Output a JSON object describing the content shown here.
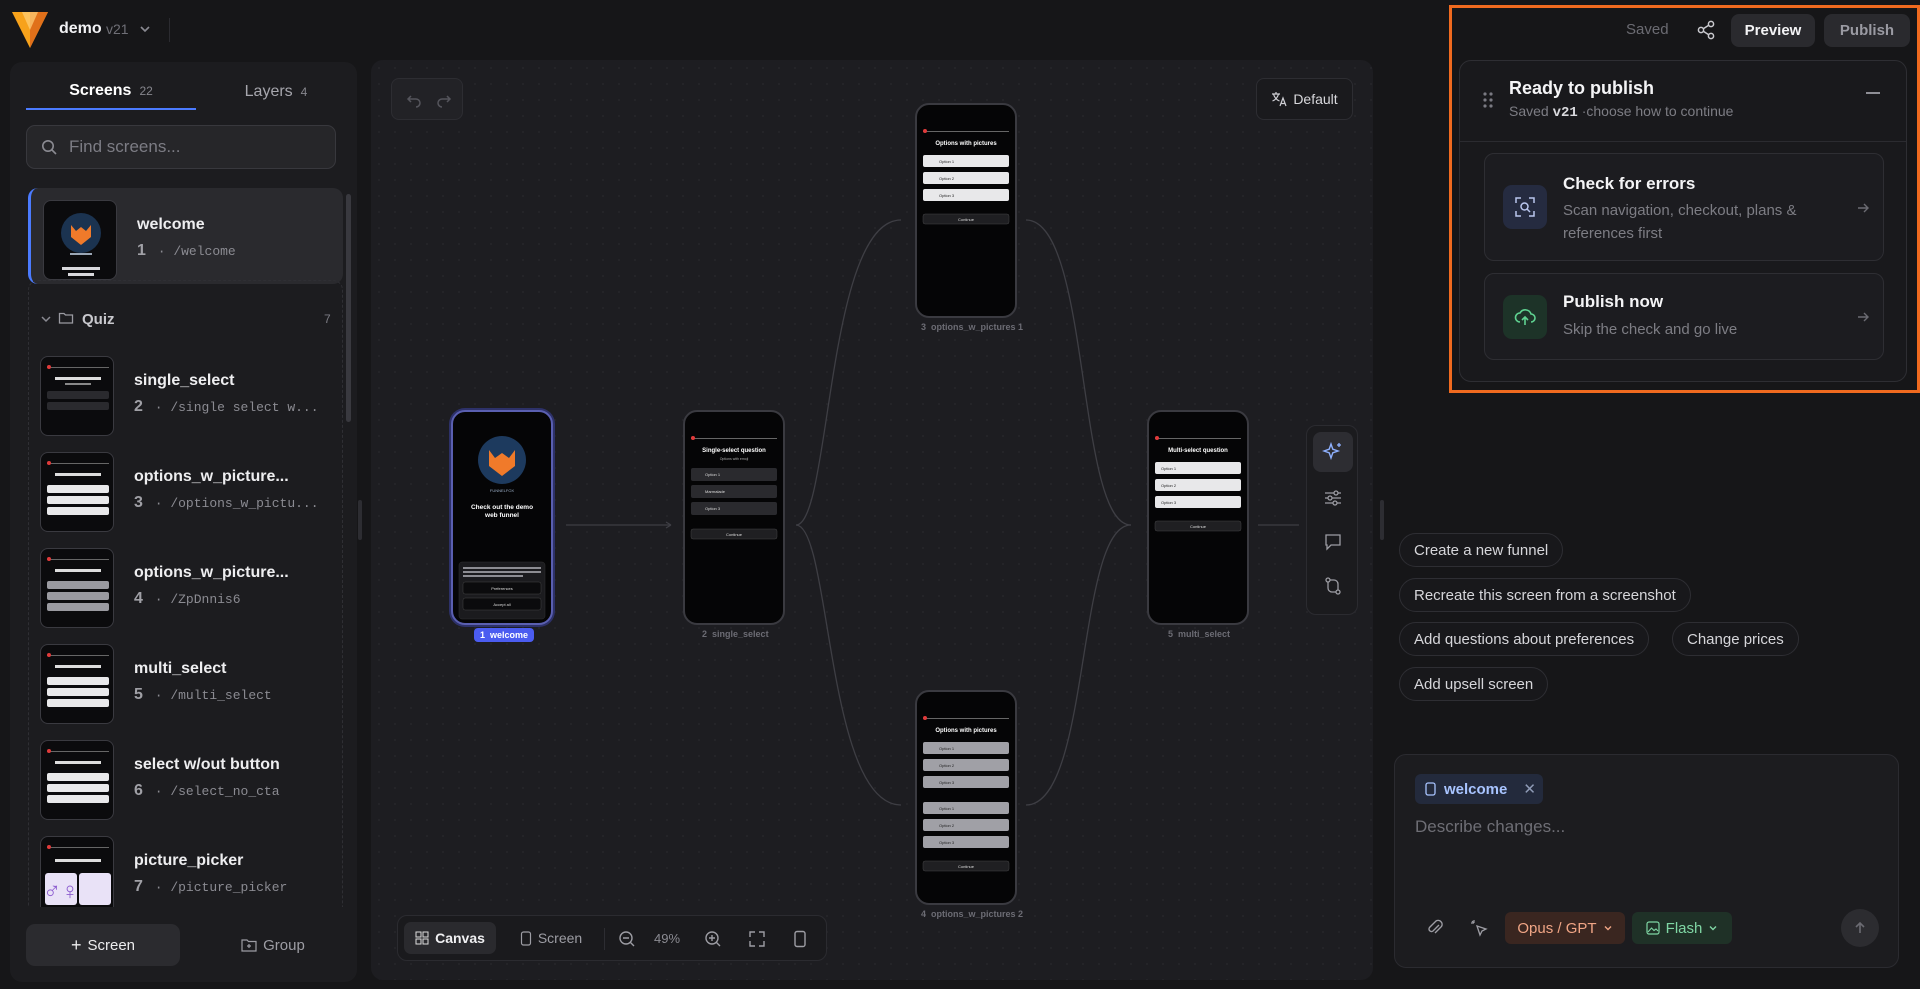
{
  "project": {
    "name": "demo",
    "version": "v21"
  },
  "header": {
    "saved_label": "Saved",
    "preview_label": "Preview",
    "publish_label": "Publish"
  },
  "sidebar": {
    "tabs": [
      {
        "label": "Screens",
        "count": "22"
      },
      {
        "label": "Layers",
        "count": "4"
      }
    ],
    "search_placeholder": "Find screens...",
    "screens": [
      {
        "name": "welcome",
        "number": "1",
        "path": "/welcome"
      },
      {
        "name": "single_select",
        "number": "2",
        "path": "/single select w..."
      },
      {
        "name": "options_w_picture...",
        "number": "3",
        "path": "/options_w_pictu..."
      },
      {
        "name": "options_w_picture...",
        "number": "4",
        "path": "/ZpDnnis6"
      },
      {
        "name": "multi_select",
        "number": "5",
        "path": "/multi_select"
      },
      {
        "name": "select w/out button",
        "number": "6",
        "path": "/select_no_cta"
      },
      {
        "name": "picture_picker",
        "number": "7",
        "path": "/picture_picker"
      }
    ],
    "group": {
      "name": "Quiz",
      "count": "7"
    },
    "add_screen_label": "Screen",
    "add_group_label": "Group"
  },
  "canvas": {
    "default_label": "Default",
    "toolbar": {
      "canvas_label": "Canvas",
      "screen_label": "Screen",
      "zoom": "49%"
    },
    "nodes": [
      {
        "number": "1",
        "label": "welcome",
        "title": "Check out the demo web funnel",
        "brand": "FUNNELFOX",
        "consent": "We use cookies to offer a better browsing experience, analyze site traffic, personalize content, and serve targeted advertisements.",
        "btn1": "Preferences",
        "btn2": "Accept all"
      },
      {
        "number": "2",
        "label": "single_select",
        "title": "Single-select question",
        "subtitle": "Options with emoji",
        "options": [
          "Option 1",
          "Marmalade",
          "Option 3"
        ],
        "cta": "Continue"
      },
      {
        "number": "3",
        "label": "options_w_pictures 1",
        "title": "Options with pictures",
        "options": [
          "Option 1",
          "Option 2",
          "Option 3"
        ],
        "cta": "Continue"
      },
      {
        "number": "4",
        "label": "options_w_pictures 2",
        "title": "Options with pictures",
        "options": [
          "Option 1",
          "Option 2",
          "Option 3",
          "Option 1",
          "Option 2",
          "Option 3"
        ],
        "cta": "Continue"
      },
      {
        "number": "5",
        "label": "multi_select",
        "title": "Multi-select question",
        "options": [
          "Option 1",
          "Option 2",
          "Option 3"
        ],
        "cta": "Continue"
      }
    ]
  },
  "assistant": {
    "suggestions": [
      "Create a new funnel",
      "Recreate this screen from a screenshot",
      "Add questions about preferences",
      "Change prices",
      "Add upsell screen"
    ],
    "context_chip": "welcome",
    "input_placeholder": "Describe changes...",
    "model_label": "Opus / GPT",
    "flash_label": "Flash"
  },
  "publish_popover": {
    "title": "Ready to publish",
    "subtitle_prefix": "Saved",
    "subtitle_version": "v21",
    "subtitle_suffix": "·choose how to continue",
    "options": [
      {
        "title": "Check for errors",
        "desc": "Scan navigation, checkout, plans & references first"
      },
      {
        "title": "Publish now",
        "desc": "Skip the check and go live"
      }
    ]
  },
  "colors": {
    "accent": "#4b7bff",
    "highlight": "#f06a1f",
    "brand": "#f7a21b"
  },
  "thumbnail_glyphs": "♂♀"
}
